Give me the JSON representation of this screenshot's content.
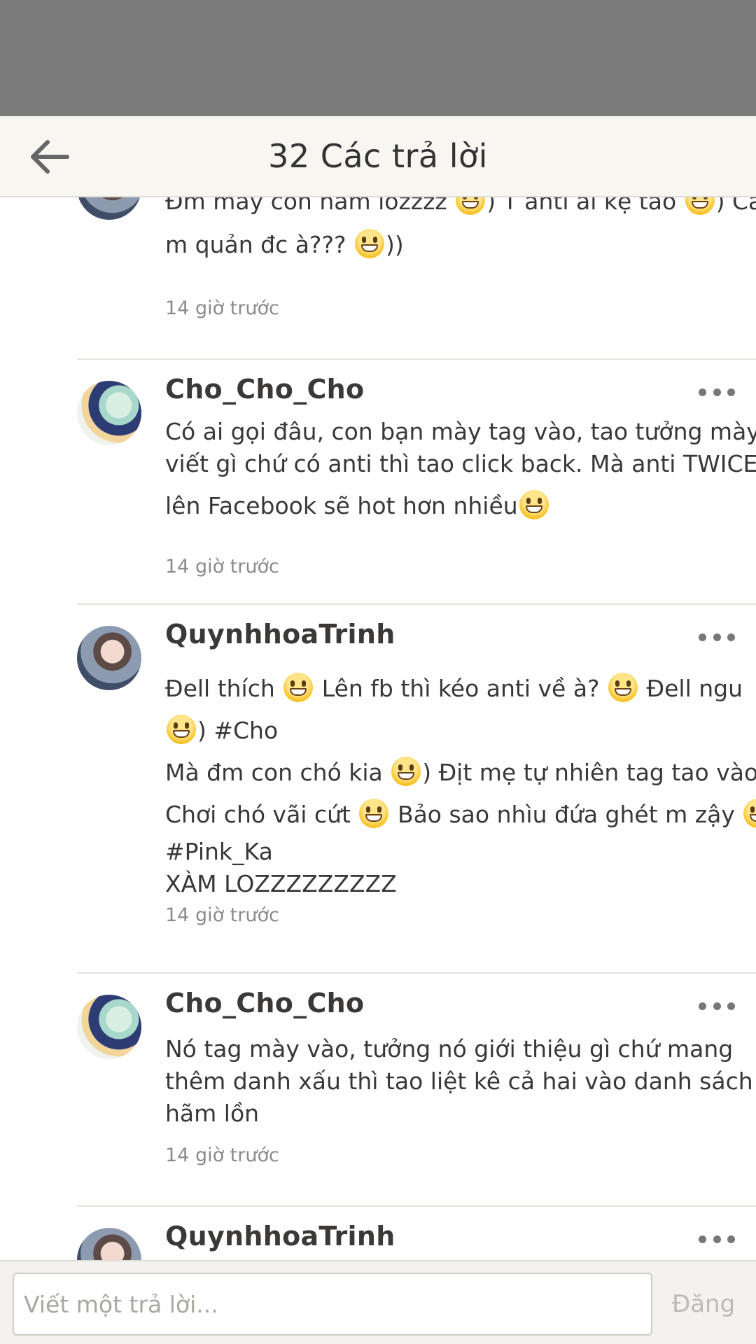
{
  "header": {
    "title": "32 Các trả lời"
  },
  "comments": [
    {
      "lines": [
        "Đm mấy con hãm lozzzz ",
        ") T anti ai kệ tao ",
        ") Các",
        "m quản đc à??? ",
        "))"
      ],
      "time": "14 giờ trước"
    },
    {
      "username": "Cho_Cho_Cho",
      "lines": [
        "Có ai gọi đâu, con bạn mày tag vào, tao tưởng mày",
        "viết gì chứ có anti thì tao click back. Mà anti TWICE thì",
        "lên Facebook sẽ hot hơn nhiều"
      ],
      "time": "14 giờ trước"
    },
    {
      "username": "QuynhhoaTrinh",
      "lines": [
        "Đell thích ",
        " Lên fb thì kéo anti về à? ",
        " Đell ngu",
        ") #Cho",
        "Mà đm con chó kia ",
        ") Địt mẹ tự nhiên tag tao vào?",
        "Chơi chó vãi cứt ",
        " Bảo sao nhìu đứa ghét m zậy ",
        "#Pink_Ka",
        "XÀM LOZZZZZZZZZ"
      ],
      "time": "14 giờ trước"
    },
    {
      "username": "Cho_Cho_Cho",
      "lines": [
        "Nó tag mày vào, tưởng nó giới thiệu gì chứ mang",
        "thêm danh xấu thì tao liệt kê cả hai vào danh sách",
        "hãm lồn"
      ],
      "time": "14 giờ trước"
    },
    {
      "username": "QuynhhoaTrinh"
    }
  ],
  "reply": {
    "placeholder": "Viết một trả lời...",
    "post_label": "Đăng"
  }
}
